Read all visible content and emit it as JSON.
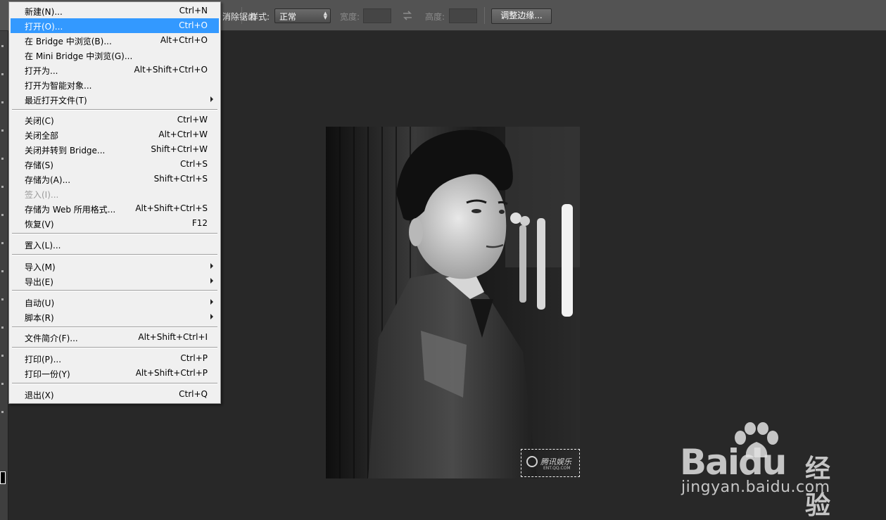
{
  "options_bar": {
    "hidden_label_fragment": "调整边缘",
    "partial_label": "消除锯齿",
    "style_label": "样式:",
    "style_value": "正常",
    "width_label": "宽度:",
    "height_label": "高度:",
    "refine_edge_button": "调整边缘..."
  },
  "file_menu": {
    "items": [
      {
        "label": "新建(N)...",
        "shortcut": "Ctrl+N"
      },
      {
        "label": "打开(O)...",
        "shortcut": "Ctrl+O",
        "state": "highlighted"
      },
      {
        "label": "在 Bridge 中浏览(B)...",
        "shortcut": "Alt+Ctrl+O"
      },
      {
        "label": "在 Mini Bridge 中浏览(G)...",
        "shortcut": ""
      },
      {
        "label": "打开为...",
        "shortcut": "Alt+Shift+Ctrl+O"
      },
      {
        "label": "打开为智能对象...",
        "shortcut": ""
      },
      {
        "label": "最近打开文件(T)",
        "shortcut": "",
        "submenu": true
      },
      {
        "label": "关闭(C)",
        "shortcut": "Ctrl+W"
      },
      {
        "label": "关闭全部",
        "shortcut": "Alt+Ctrl+W"
      },
      {
        "label": "关闭并转到 Bridge...",
        "shortcut": "Shift+Ctrl+W"
      },
      {
        "label": "存储(S)",
        "shortcut": "Ctrl+S"
      },
      {
        "label": "存储为(A)...",
        "shortcut": "Shift+Ctrl+S"
      },
      {
        "label": "签入(I)...",
        "shortcut": "",
        "state": "disabled"
      },
      {
        "label": "存储为 Web 所用格式...",
        "shortcut": "Alt+Shift+Ctrl+S"
      },
      {
        "label": "恢复(V)",
        "shortcut": "F12"
      },
      {
        "label": "置入(L)...",
        "shortcut": ""
      },
      {
        "label": "导入(M)",
        "shortcut": "",
        "submenu": true
      },
      {
        "label": "导出(E)",
        "shortcut": "",
        "submenu": true
      },
      {
        "label": "自动(U)",
        "shortcut": "",
        "submenu": true
      },
      {
        "label": "脚本(R)",
        "shortcut": "",
        "submenu": true
      },
      {
        "label": "文件简介(F)...",
        "shortcut": "Alt+Shift+Ctrl+I"
      },
      {
        "label": "打印(P)...",
        "shortcut": "Ctrl+P"
      },
      {
        "label": "打印一份(Y)",
        "shortcut": "Alt+Shift+Ctrl+P"
      },
      {
        "label": "退出(X)",
        "shortcut": "Ctrl+Q"
      }
    ]
  },
  "document": {
    "watermark_text": "腾讯娱乐",
    "watermark_sub": "ENT.QQ.COM"
  },
  "baidu_watermark": {
    "logo_left": "Bai",
    "logo_right": "du",
    "brand_cn": "经验",
    "url": "jingyan.baidu.com"
  },
  "colors": {
    "menu_highlight": "#3399ff",
    "menu_bg": "#f0f0f0",
    "workspace_bg": "#282828",
    "options_bar_bg": "#535353"
  }
}
